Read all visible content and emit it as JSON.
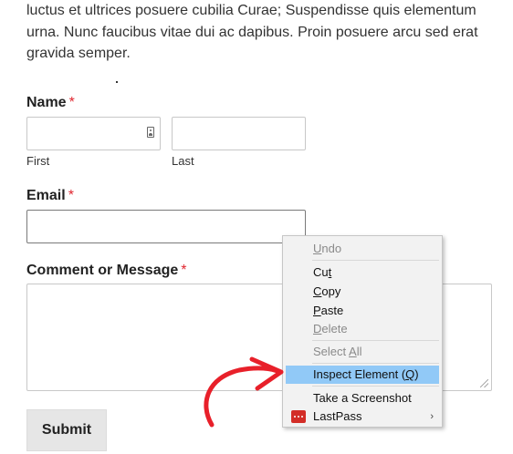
{
  "intro": {
    "line1": "luctus et ultrices posuere cubilia Curae; Suspendisse quis elementum",
    "line2": "urna. Nunc faucibus vitae dui ac dapibus. Proin posuere arcu sed erat",
    "line3": "gravida semper."
  },
  "form": {
    "name_label": "Name",
    "required_mark": "*",
    "first_label": "First",
    "last_label": "Last",
    "email_label": "Email",
    "comment_label": "Comment or Message",
    "submit_label": "Submit"
  },
  "context_menu": {
    "undo": "Undo",
    "cut": "Cut",
    "copy": "Copy",
    "paste": "Paste",
    "delete": "Delete",
    "select_all": "Select All",
    "inspect": "Inspect Element (Q)",
    "screenshot": "Take a Screenshot",
    "lastpass": "LastPass"
  },
  "colors": {
    "required": "#e0262f",
    "highlight": "#91c9f7",
    "annotation_arrow": "#e8202a"
  }
}
